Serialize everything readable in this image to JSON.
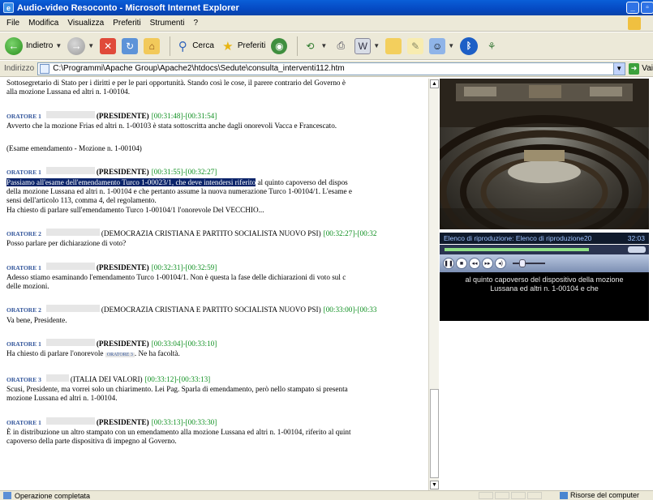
{
  "window": {
    "title": "Audio-video Resoconto - Microsoft Internet Explorer",
    "min_glyph": "_",
    "max_glyph": "▫"
  },
  "menu": [
    "File",
    "Modifica",
    "Visualizza",
    "Preferiti",
    "Strumenti",
    "?"
  ],
  "toolbar": {
    "back_label": "Indietro",
    "search_label": "Cerca",
    "favorites_label": "Preferiti"
  },
  "address": {
    "label": "Indirizzo",
    "url": "C:\\Programmi\\Apache Group\\Apache2\\htdocs\\Sedute\\consulta_interventi112.htm",
    "go_label": "Vai"
  },
  "transcript": {
    "intro_lines": [
      "Sottosegretario di Stato per i diritti e per le pari opportunità. Stando così le cose, il parere contrario del Governo è",
      "alla mozione Lussana ed altri n. 1-00104."
    ],
    "entries": [
      {
        "speaker": "ORATORE 1",
        "role": "(PRESIDENTE)",
        "time": "[00:31:48]-[00:31:54]",
        "lines": [
          "Avverto che la mozione Frias ed altri n. 1-00103 è stata sottoscritta anche dagli onorevoli Vacca e Francescato."
        ]
      }
    ],
    "note": "(Esame emendamento - Mozione n. 1-00104)",
    "entry2": {
      "speaker": "ORATORE 1",
      "role": "(PRESIDENTE)",
      "time": "[00:31:55]-[00:32:27]",
      "highlight": "Passiamo all'esame dell'emendamento Turco 1-00023/1, che deve intendersi riferito",
      "line1_rest": " al quinto capoverso del dispos",
      "lines": [
        "della mozione Lussana ed altri n. 1-00104 e che pertanto assume la nuova numerazione Turco 1-00104/1. L'esame e",
        "sensi dell'articolo 113, comma 4, del regolamento.",
        "Ha chiesto di parlare sull'emendamento Turco 1-00104/1 l'onorevole Del VECCHIO..."
      ]
    },
    "entry3": {
      "speaker": "ORATORE 2",
      "role": "(DEMOCRAZIA CRISTIANA E PARTITO SOCIALISTA NUOVO PSI)",
      "time": "[00:32:27]-[00:32",
      "lines": [
        "Posso parlare per dichiarazione di voto?"
      ]
    },
    "entry4": {
      "speaker": "ORATORE 1",
      "role": "(PRESIDENTE)",
      "time": "[00:32:31]-[00:32:59]",
      "lines": [
        "Adesso stiamo esaminando l'emendamento Turco 1-00104/1. Non è questa la fase delle dichiarazioni di voto sul c",
        "delle mozioni."
      ]
    },
    "entry5": {
      "speaker": "ORATORE 2",
      "role": "(DEMOCRAZIA CRISTIANA E PARTITO SOCIALISTA NUOVO PSI)",
      "time": "[00:33:00]-[00:33",
      "lines": [
        "Va bene, Presidente."
      ]
    },
    "entry6": {
      "speaker": "ORATORE 1",
      "role": "(PRESIDENTE)",
      "time": "[00:33:04]-[00:33:10]",
      "line_pre": "Ha chiesto di parlare l'onorevole ",
      "inline_tag": "ORATORE 3",
      "line_post": ". Ne ha facoltà."
    },
    "entry7": {
      "speaker": "ORATORE 3",
      "role": "(ITALIA DEI VALORI)",
      "time": "[00:33:12]-[00:33:13]",
      "lines": [
        "Scusi, Presidente, ma vorrei solo un chiarimento. Lei Pag. Sparla di emendamento, però nello stampato si presenta",
        "mozione Lussana ed altri n. 1-00104."
      ]
    },
    "entry8": {
      "speaker": "ORATORE 1",
      "role": "(PRESIDENTE)",
      "time": "[00:33:13]-[00:33:30]",
      "lines": [
        "È in distribuzione un altro stampato con un emendamento alla mozione Lussana ed altri n. 1-00104, riferito al quint",
        "capoverso della parte dispositiva di impegno al Governo."
      ]
    }
  },
  "player": {
    "playlist_label": "Elenco di riproduzione: Elenco di riproduzione20",
    "time": "32:03",
    "playback_progress": 0.8,
    "caption_line1": "al quinto capoverso del dispositivo della mozione",
    "caption_line2": "Lussana ed altri n. 1-00104 e che"
  },
  "status": {
    "text": "Operazione completata",
    "zone": "Risorse del computer"
  },
  "colors": {
    "speaker": "#33569b",
    "timestamp": "#0d8f1f",
    "highlight_bg": "#0b246a"
  }
}
